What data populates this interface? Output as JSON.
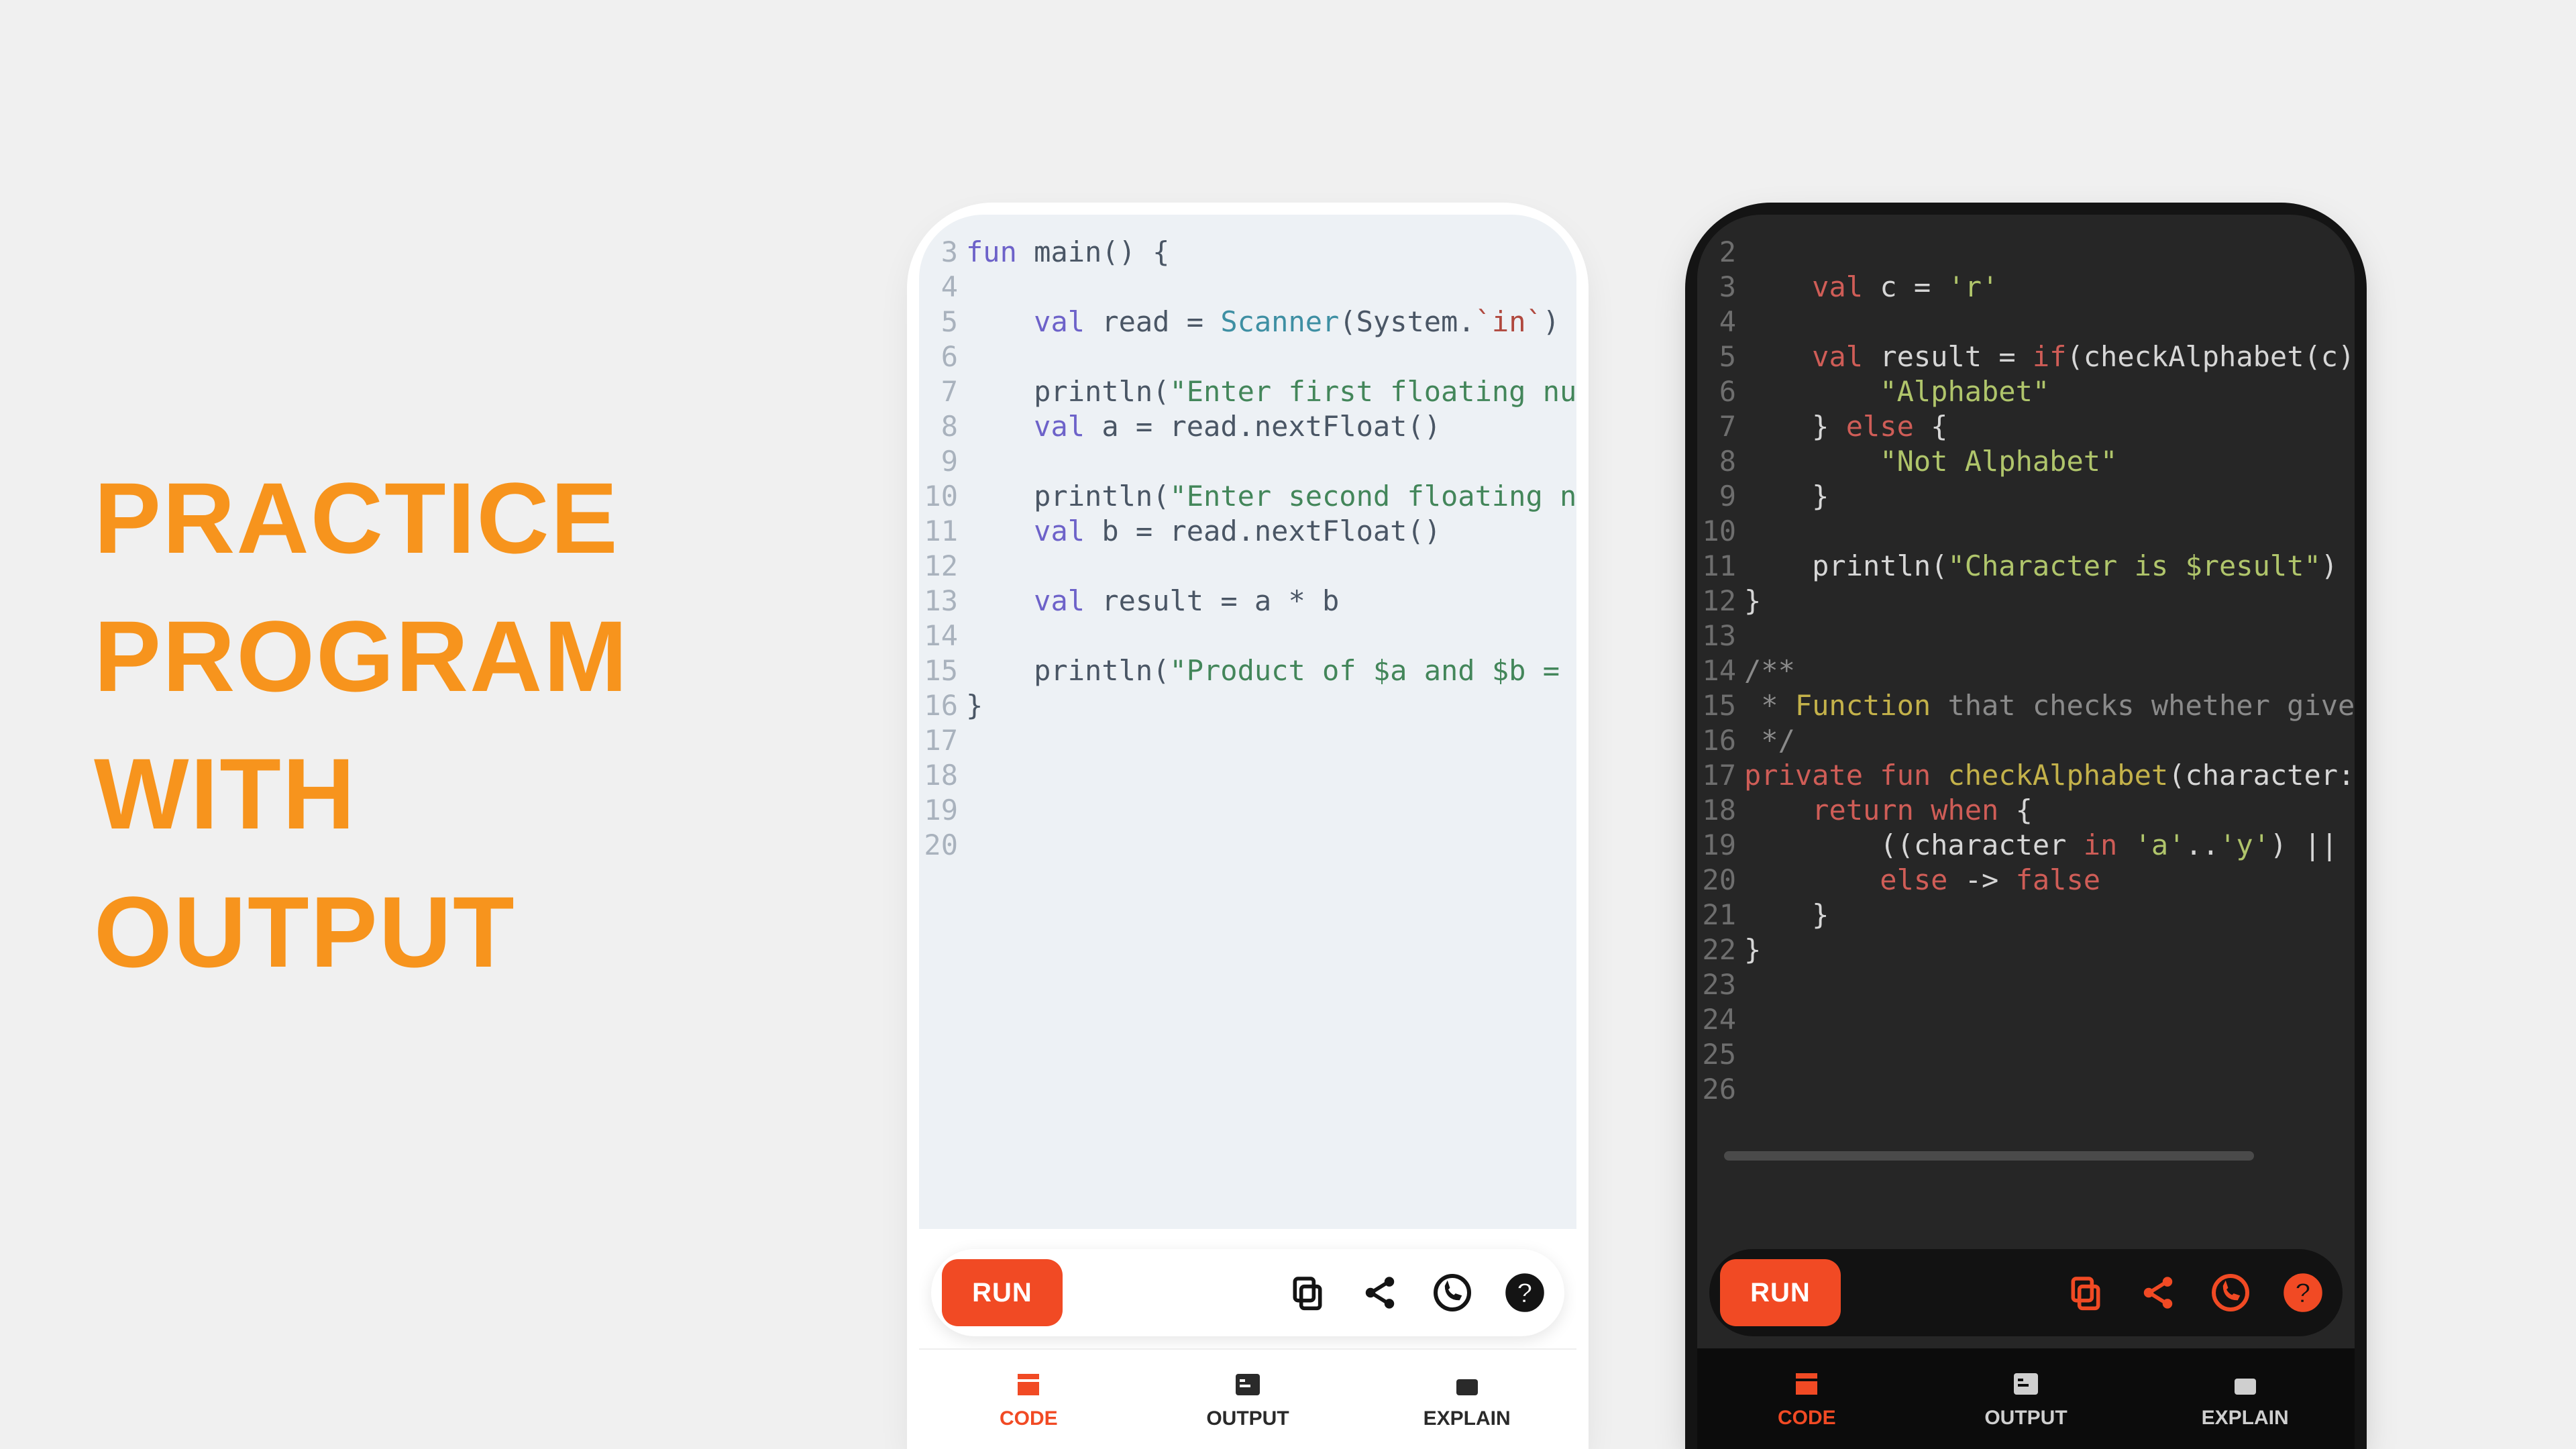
{
  "headline": {
    "l1": "PRACTICE",
    "l2": "PROGRAM",
    "l3": "WITH",
    "l4": "OUTPUT"
  },
  "actions": {
    "run": "RUN",
    "copy_icon": "copy",
    "share_icon": "share",
    "whatsapp_icon": "whatsapp",
    "help_icon": "help"
  },
  "tabs": {
    "code": "CODE",
    "output": "OUTPUT",
    "explain": "EXPLAIN"
  },
  "phone_light": {
    "gutter_start": 3,
    "gutter_end": 20,
    "code_lines": [
      {
        "indent": 0,
        "tokens": [
          {
            "t": "fun ",
            "c": "kw"
          },
          {
            "t": "main() {",
            "c": ""
          }
        ]
      },
      {
        "indent": 0,
        "tokens": []
      },
      {
        "indent": 1,
        "tokens": [
          {
            "t": "val ",
            "c": "kw"
          },
          {
            "t": "read = ",
            "c": ""
          },
          {
            "t": "Scanner",
            "c": "fn"
          },
          {
            "t": "(System.",
            "c": ""
          },
          {
            "t": "`in`",
            "c": "rd"
          },
          {
            "t": ")",
            "c": ""
          }
        ]
      },
      {
        "indent": 0,
        "tokens": []
      },
      {
        "indent": 1,
        "tokens": [
          {
            "t": "println(",
            "c": ""
          },
          {
            "t": "\"Enter first floating numb",
            "c": "str"
          }
        ]
      },
      {
        "indent": 1,
        "tokens": [
          {
            "t": "val ",
            "c": "kw"
          },
          {
            "t": "a = read.nextFloat()",
            "c": ""
          }
        ]
      },
      {
        "indent": 0,
        "tokens": []
      },
      {
        "indent": 1,
        "tokens": [
          {
            "t": "println(",
            "c": ""
          },
          {
            "t": "\"Enter second floating num",
            "c": "str"
          }
        ]
      },
      {
        "indent": 1,
        "tokens": [
          {
            "t": "val ",
            "c": "kw"
          },
          {
            "t": "b = read.nextFloat()",
            "c": ""
          }
        ]
      },
      {
        "indent": 0,
        "tokens": []
      },
      {
        "indent": 1,
        "tokens": [
          {
            "t": "val ",
            "c": "kw"
          },
          {
            "t": "result = a * b",
            "c": ""
          }
        ]
      },
      {
        "indent": 0,
        "tokens": []
      },
      {
        "indent": 1,
        "tokens": [
          {
            "t": "println(",
            "c": ""
          },
          {
            "t": "\"Product of $a and $b = $r",
            "c": "str"
          }
        ]
      },
      {
        "indent": 0,
        "tokens": [
          {
            "t": "}",
            "c": ""
          }
        ]
      },
      {
        "indent": 0,
        "tokens": []
      },
      {
        "indent": 0,
        "tokens": []
      },
      {
        "indent": 0,
        "tokens": []
      },
      {
        "indent": 0,
        "tokens": []
      }
    ]
  },
  "phone_dark": {
    "gutter_start": 2,
    "gutter_end": 26,
    "code_lines": [
      {
        "indent": 0,
        "tokens": []
      },
      {
        "indent": 1,
        "tokens": [
          {
            "t": "val ",
            "c": "kw"
          },
          {
            "t": "c = ",
            "c": ""
          },
          {
            "t": "'r'",
            "c": "str"
          }
        ]
      },
      {
        "indent": 0,
        "tokens": []
      },
      {
        "indent": 1,
        "tokens": [
          {
            "t": "val ",
            "c": "kw"
          },
          {
            "t": "result = ",
            "c": ""
          },
          {
            "t": "if",
            "c": "kw"
          },
          {
            "t": "(checkAlphabet(c))",
            "c": ""
          }
        ]
      },
      {
        "indent": 2,
        "tokens": [
          {
            "t": "\"Alphabet\"",
            "c": "str"
          }
        ]
      },
      {
        "indent": 1,
        "tokens": [
          {
            "t": "} ",
            "c": ""
          },
          {
            "t": "else",
            "c": "kw"
          },
          {
            "t": " {",
            "c": ""
          }
        ]
      },
      {
        "indent": 2,
        "tokens": [
          {
            "t": "\"Not Alphabet\"",
            "c": "str"
          }
        ]
      },
      {
        "indent": 1,
        "tokens": [
          {
            "t": "}",
            "c": ""
          }
        ]
      },
      {
        "indent": 0,
        "tokens": []
      },
      {
        "indent": 1,
        "tokens": [
          {
            "t": "println(",
            "c": ""
          },
          {
            "t": "\"Character is $result\"",
            "c": "str"
          },
          {
            "t": ")",
            "c": ""
          }
        ]
      },
      {
        "indent": 0,
        "tokens": [
          {
            "t": "}",
            "c": ""
          }
        ]
      },
      {
        "indent": 0,
        "tokens": []
      },
      {
        "indent": 0,
        "tokens": [
          {
            "t": "/**",
            "c": "cmt"
          }
        ]
      },
      {
        "indent": 0,
        "tokens": [
          {
            "t": " * ",
            "c": "cmt"
          },
          {
            "t": "Function",
            "c": "fn"
          },
          {
            "t": " that checks whether given",
            "c": "cmt"
          }
        ]
      },
      {
        "indent": 0,
        "tokens": [
          {
            "t": " */",
            "c": "cmt"
          }
        ]
      },
      {
        "indent": 0,
        "tokens": [
          {
            "t": "private fun ",
            "c": "kw"
          },
          {
            "t": "checkAlphabet",
            "c": "fn"
          },
          {
            "t": "(character: C",
            "c": ""
          }
        ]
      },
      {
        "indent": 1,
        "tokens": [
          {
            "t": "return when",
            "c": "kw"
          },
          {
            "t": " {",
            "c": ""
          }
        ]
      },
      {
        "indent": 2,
        "tokens": [
          {
            "t": "((character ",
            "c": ""
          },
          {
            "t": "in",
            "c": "kw"
          },
          {
            "t": " ",
            "c": ""
          },
          {
            "t": "'a'",
            "c": "str"
          },
          {
            "t": "..",
            "c": ""
          },
          {
            "t": "'y'",
            "c": "str"
          },
          {
            "t": ") || (c",
            "c": ""
          }
        ]
      },
      {
        "indent": 2,
        "tokens": [
          {
            "t": "else",
            "c": "kw"
          },
          {
            "t": " -> ",
            "c": ""
          },
          {
            "t": "false",
            "c": "kw"
          }
        ]
      },
      {
        "indent": 1,
        "tokens": [
          {
            "t": "}",
            "c": ""
          }
        ]
      },
      {
        "indent": 0,
        "tokens": [
          {
            "t": "}",
            "c": ""
          }
        ]
      },
      {
        "indent": 0,
        "tokens": []
      },
      {
        "indent": 0,
        "tokens": []
      },
      {
        "indent": 0,
        "tokens": []
      },
      {
        "indent": 0,
        "tokens": []
      }
    ]
  }
}
